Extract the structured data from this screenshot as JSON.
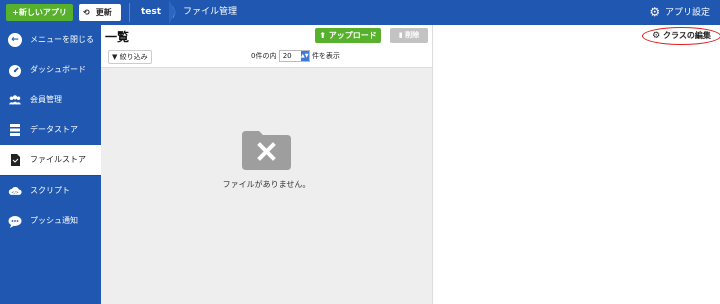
{
  "topbar": {
    "new_app_label": "+新しいアプリ",
    "refresh_label": "更新",
    "refresh_icon": "⟲",
    "app_name": "test",
    "breadcrumb": "ファイル管理",
    "settings_label": "アプリ設定",
    "colors": {
      "bar": "#1f57b1",
      "new_button": "#57b12d"
    }
  },
  "sidebar": {
    "items": [
      {
        "label": "メニューを閉じる",
        "icon": "arrow-left-circle-icon"
      },
      {
        "label": "ダッシュボード",
        "icon": "dashboard-icon"
      },
      {
        "label": "会員管理",
        "icon": "users-icon"
      },
      {
        "label": "データストア",
        "icon": "database-icon"
      },
      {
        "label": "ファイルストア",
        "icon": "file-icon",
        "active": true
      },
      {
        "label": "スクリプト",
        "icon": "cloud-script-icon"
      },
      {
        "label": "プッシュ通知",
        "icon": "chat-bubble-icon"
      }
    ]
  },
  "main": {
    "title": "一覧",
    "upload_label": "アップロード",
    "delete_label": "削除",
    "filter_label": "絞り込み",
    "pager": {
      "prefix": "0件の内",
      "page_size": "20",
      "suffix": "件を表示"
    },
    "empty_message": "ファイルがありません。"
  },
  "right_panel": {
    "edit_class_label": "クラスの編集"
  }
}
